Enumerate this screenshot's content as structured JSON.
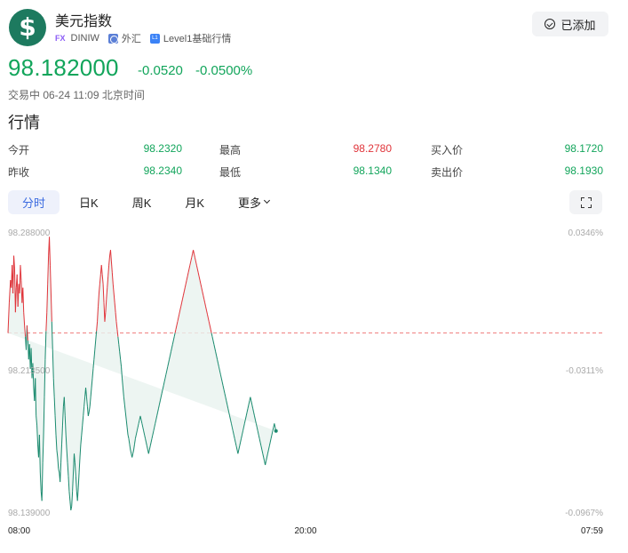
{
  "header": {
    "logo_symbol": "$",
    "title": "美元指数",
    "fx_tag": "FX",
    "code": "DINIW",
    "market": "外汇",
    "level_icon": "L1",
    "level": "Level1基础行情",
    "added_label": "已添加"
  },
  "quote": {
    "price": "98.182000",
    "change": "-0.0520",
    "change_pct": "-0.0500%",
    "status": "交易中 06-24 11:09 北京时间"
  },
  "section_title": "行情",
  "stats": [
    {
      "label": "今开",
      "value": "98.2320",
      "color": "green"
    },
    {
      "label": "最高",
      "value": "98.2780",
      "color": "red"
    },
    {
      "label": "买入价",
      "value": "98.1720",
      "color": "green"
    },
    {
      "label": "昨收",
      "value": "98.2340",
      "color": "green"
    },
    {
      "label": "最低",
      "value": "98.1340",
      "color": "green"
    },
    {
      "label": "卖出价",
      "value": "98.1930",
      "color": "green"
    }
  ],
  "tabs": {
    "intraday": "分时",
    "daily": "日K",
    "weekly": "周K",
    "monthly": "月K",
    "more": "更多"
  },
  "colors": {
    "up": "#e0343a",
    "down": "#12a55b",
    "line_down": "#1a8a6e",
    "active_tab": "#3b6be0",
    "prev_close_line": "#f08080"
  },
  "chart_data": {
    "type": "line",
    "y_left_ticks": [
      "98.288000",
      "98.213500",
      "98.139000"
    ],
    "y_right_ticks": [
      "0.0346%",
      "-0.0311%",
      "-0.0967%"
    ],
    "x_ticks": [
      "08:00",
      "20:00",
      "07:59"
    ],
    "ylim": [
      98.139,
      98.288
    ],
    "prev_close": 98.234,
    "x_range": [
      0,
      1439
    ],
    "x_minutes": [
      0,
      3,
      6,
      8,
      10,
      12,
      14,
      16,
      18,
      20,
      22,
      24,
      26,
      28,
      30,
      32,
      34,
      36,
      38,
      40,
      42,
      44,
      46,
      48,
      50,
      52,
      54,
      56,
      58,
      60,
      62,
      64,
      66,
      68,
      70,
      72,
      74,
      76,
      78,
      80,
      82,
      84,
      86,
      88,
      90,
      92,
      94,
      96,
      98,
      100,
      102,
      104,
      106,
      108,
      110,
      112,
      114,
      116,
      118,
      120,
      122,
      124,
      126,
      128,
      130,
      132,
      134,
      136,
      138,
      140,
      142,
      144,
      146,
      148,
      150,
      152,
      154,
      156,
      158,
      160,
      162,
      164,
      166,
      168,
      170,
      172,
      174,
      176,
      178,
      180,
      182,
      184,
      186,
      188,
      190,
      192,
      194,
      196,
      198,
      200,
      202,
      204,
      206,
      208,
      210,
      212,
      214,
      216,
      218,
      220,
      222,
      224,
      226,
      228,
      230,
      232,
      234,
      236,
      238,
      240,
      242,
      244,
      246,
      248,
      250,
      252,
      254,
      256,
      258,
      260,
      262,
      264,
      266,
      268,
      270,
      272,
      274,
      276,
      278,
      280,
      282,
      284,
      286,
      288,
      290,
      292,
      294,
      296,
      298,
      300,
      302,
      304,
      306,
      308,
      310,
      312,
      314,
      316,
      318,
      320,
      322,
      324,
      326,
      328,
      330,
      332,
      334,
      336,
      338,
      340,
      342,
      344,
      346,
      348,
      350,
      352,
      354,
      356,
      358,
      360,
      362,
      364,
      366,
      368,
      370,
      372,
      374,
      376,
      378,
      380,
      382,
      384,
      386,
      388,
      390,
      392,
      394,
      396,
      398,
      400,
      402,
      404,
      406,
      408,
      410,
      412,
      414,
      416,
      418,
      420,
      422,
      424,
      426,
      428,
      430,
      432,
      434,
      436,
      438,
      440,
      442,
      444,
      446,
      448,
      450,
      452,
      454,
      456,
      458,
      460,
      462,
      464,
      466,
      468,
      470,
      472,
      474,
      476,
      478,
      480,
      482,
      484,
      486,
      488,
      490,
      492,
      494,
      496,
      498,
      500,
      502,
      504,
      506,
      508,
      510,
      512,
      514,
      516,
      518,
      520,
      522,
      524,
      526,
      528,
      530,
      532,
      534,
      536,
      538,
      540,
      542,
      544,
      546,
      548,
      550,
      552,
      554,
      556,
      558,
      560,
      562,
      564,
      566,
      568,
      570,
      572,
      574,
      576,
      578,
      580,
      582,
      584,
      586,
      588,
      590,
      592,
      594,
      596,
      598,
      600,
      602,
      604,
      606,
      608,
      610,
      612,
      614,
      616,
      618,
      620,
      622,
      624,
      626,
      628,
      630,
      632,
      634,
      636,
      638,
      640,
      642,
      644,
      646,
      648,
      650,
      652,
      654,
      656,
      658,
      660,
      662,
      664,
      666,
      668,
      670,
      672,
      674,
      676,
      678,
      680
    ],
    "values": [
      98.234,
      98.25,
      98.262,
      98.258,
      98.27,
      98.255,
      98.275,
      98.268,
      98.245,
      98.258,
      98.265,
      98.248,
      98.26,
      98.255,
      98.27,
      98.262,
      98.25,
      98.258,
      98.245,
      98.238,
      98.232,
      98.225,
      98.238,
      98.23,
      98.22,
      98.228,
      98.215,
      98.226,
      98.21,
      98.218,
      98.205,
      98.198,
      98.21,
      98.19,
      98.185,
      98.175,
      98.168,
      98.18,
      98.16,
      98.15,
      98.145,
      98.165,
      98.18,
      98.2,
      98.22,
      98.235,
      98.245,
      98.26,
      98.275,
      98.285,
      98.27,
      98.255,
      98.24,
      98.225,
      98.21,
      98.2,
      98.19,
      98.18,
      98.172,
      98.168,
      98.162,
      98.16,
      98.155,
      98.165,
      98.175,
      98.185,
      98.195,
      98.2,
      98.19,
      98.18,
      98.172,
      98.165,
      98.158,
      98.15,
      98.145,
      98.14,
      98.142,
      98.15,
      98.16,
      98.17,
      98.165,
      98.158,
      98.15,
      98.145,
      98.152,
      98.16,
      98.168,
      98.175,
      98.18,
      98.185,
      98.19,
      98.195,
      98.2,
      98.205,
      98.2,
      98.195,
      98.19,
      98.192,
      98.195,
      98.2,
      98.205,
      98.21,
      98.215,
      98.22,
      98.225,
      98.23,
      98.235,
      98.24,
      98.248,
      98.255,
      98.26,
      98.265,
      98.27,
      98.265,
      98.26,
      98.25,
      98.24,
      98.245,
      98.252,
      98.258,
      98.264,
      98.27,
      98.275,
      98.278,
      98.272,
      98.266,
      98.26,
      98.255,
      98.25,
      98.245,
      98.24,
      98.236,
      98.232,
      98.228,
      98.224,
      98.22,
      98.216,
      98.21,
      98.205,
      98.2,
      98.196,
      98.192,
      98.188,
      98.184,
      98.18,
      98.178,
      98.175,
      98.172,
      98.17,
      98.168,
      98.17,
      98.172,
      98.175,
      98.178,
      98.18,
      98.182,
      98.184,
      98.186,
      98.188,
      98.19,
      98.188,
      98.186,
      98.184,
      98.182,
      98.18,
      98.178,
      98.176,
      98.174,
      98.172,
      98.17,
      98.172,
      98.174,
      98.176,
      98.178,
      98.18,
      98.182,
      98.184,
      98.186,
      98.188,
      98.19,
      98.192,
      98.194,
      98.196,
      98.198,
      98.2,
      98.202,
      98.204,
      98.206,
      98.208,
      98.21,
      98.212,
      98.214,
      98.216,
      98.218,
      98.22,
      98.222,
      98.224,
      98.226,
      98.228,
      98.23,
      98.232,
      98.234,
      98.236,
      98.238,
      98.24,
      98.242,
      98.244,
      98.246,
      98.248,
      98.25,
      98.252,
      98.254,
      98.256,
      98.258,
      98.26,
      98.262,
      98.264,
      98.266,
      98.268,
      98.27,
      98.272,
      98.274,
      98.276,
      98.278,
      98.276,
      98.274,
      98.272,
      98.27,
      98.268,
      98.266,
      98.264,
      98.262,
      98.26,
      98.258,
      98.256,
      98.254,
      98.252,
      98.25,
      98.248,
      98.246,
      98.244,
      98.242,
      98.24,
      98.238,
      98.236,
      98.234,
      98.232,
      98.23,
      98.228,
      98.226,
      98.224,
      98.222,
      98.22,
      98.218,
      98.216,
      98.214,
      98.212,
      98.21,
      98.208,
      98.206,
      98.204,
      98.202,
      98.2,
      98.198,
      98.196,
      98.194,
      98.192,
      98.19,
      98.188,
      98.186,
      98.184,
      98.182,
      98.18,
      98.178,
      98.176,
      98.174,
      98.172,
      98.17,
      98.172,
      98.174,
      98.176,
      98.178,
      98.18,
      98.182,
      98.184,
      98.186,
      98.188,
      98.19,
      98.192,
      98.194,
      98.196,
      98.198,
      98.2,
      98.198,
      98.196,
      98.194,
      98.192,
      98.19,
      98.188,
      98.186,
      98.184,
      98.182,
      98.18,
      98.178,
      98.176,
      98.174,
      98.172,
      98.17,
      98.168,
      98.166,
      98.164,
      98.166,
      98.168,
      98.17,
      98.172,
      98.174,
      98.176,
      98.178,
      98.18,
      98.182,
      98.184,
      98.186,
      98.184,
      98.182
    ]
  }
}
